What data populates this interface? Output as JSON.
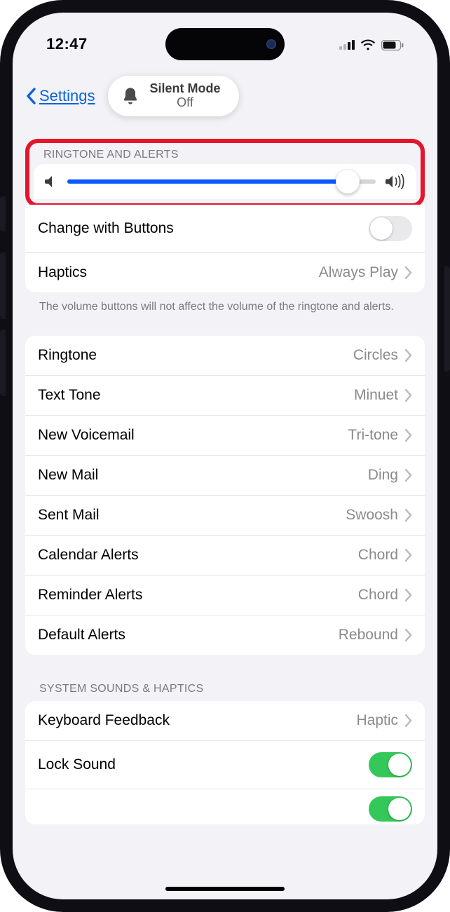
{
  "status": {
    "time": "12:47"
  },
  "nav": {
    "back_label": "Settings"
  },
  "pill": {
    "line1": "Silent Mode",
    "line2": "Off"
  },
  "section1": {
    "header": "Ringtone and Alerts",
    "slider_value": 91,
    "change_buttons_label": "Change with Buttons",
    "change_buttons_on": false,
    "haptics_label": "Haptics",
    "haptics_value": "Always Play",
    "footer": "The volume buttons will not affect the volume of the ringtone and alerts."
  },
  "section2": {
    "rows": [
      {
        "label": "Ringtone",
        "value": "Circles"
      },
      {
        "label": "Text Tone",
        "value": "Minuet"
      },
      {
        "label": "New Voicemail",
        "value": "Tri-tone"
      },
      {
        "label": "New Mail",
        "value": "Ding"
      },
      {
        "label": "Sent Mail",
        "value": "Swoosh"
      },
      {
        "label": "Calendar Alerts",
        "value": "Chord"
      },
      {
        "label": "Reminder Alerts",
        "value": "Chord"
      },
      {
        "label": "Default Alerts",
        "value": "Rebound"
      }
    ]
  },
  "section3": {
    "header": "System Sounds & Haptics",
    "keyboard_label": "Keyboard Feedback",
    "keyboard_value": "Haptic",
    "lock_label": "Lock Sound",
    "lock_on": true
  }
}
